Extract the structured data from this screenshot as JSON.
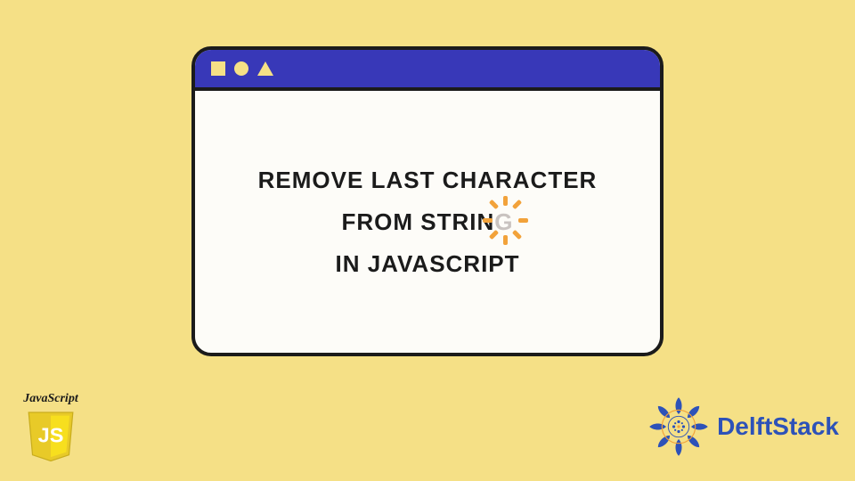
{
  "heading": {
    "line1": "REMOVE LAST CHARACTER",
    "line2_prefix": "FROM STRIN",
    "line2_fade": "G",
    "line3": "IN JAVASCRIPT"
  },
  "badges": {
    "js_label": "JavaScript",
    "js_text": "JS",
    "delft_text": "DelftStack"
  },
  "colors": {
    "background": "#f5e086",
    "titlebar": "#3838b8",
    "border": "#1b1b1b",
    "sparkle": "#f2a23a",
    "js_yellow": "#f7df1e",
    "delft_blue": "#2d52b8"
  }
}
